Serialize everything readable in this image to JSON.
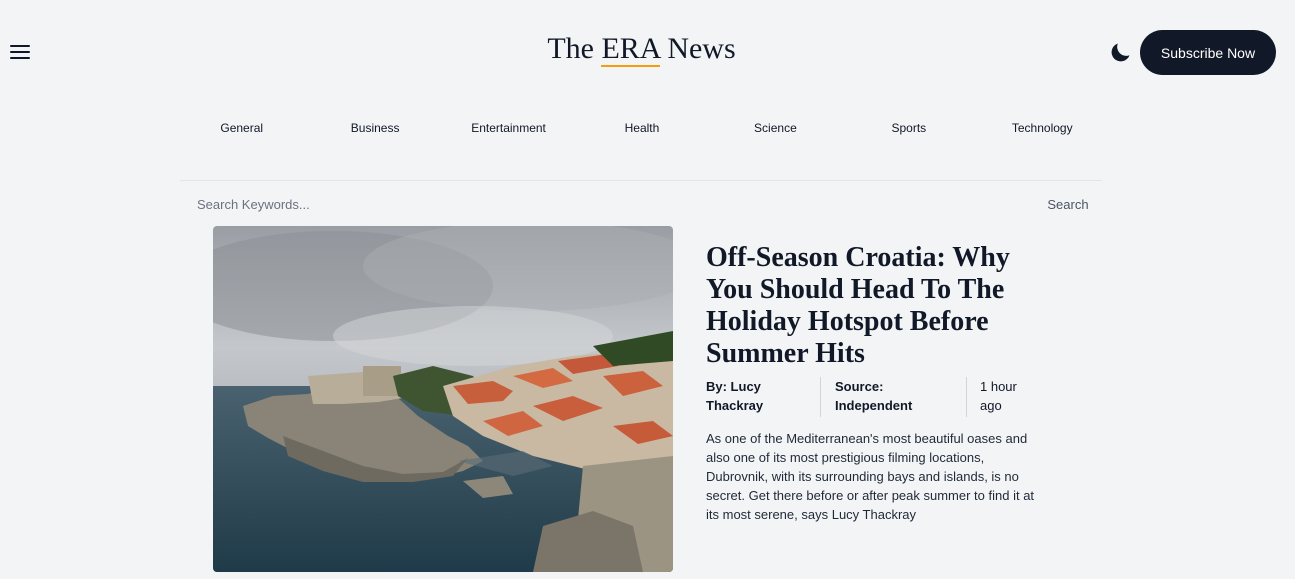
{
  "header": {
    "logo_prefix": "The ",
    "logo_highlight": "ERA",
    "logo_suffix": " News",
    "subscribe_label": "Subscribe Now"
  },
  "categories": [
    "General",
    "Business",
    "Entertainment",
    "Health",
    "Science",
    "Sports",
    "Technology"
  ],
  "search": {
    "placeholder": "Search Keywords...",
    "button_label": "Search"
  },
  "article": {
    "title": "Off-Season Croatia: Why You Should Head To The Holiday Hotspot Before Summer Hits",
    "author": "By: Lucy Thackray",
    "source": "Source: Independent",
    "time": "1 hour ago",
    "summary": "As one of the Mediterranean's most beautiful oases and also one of its most prestigious filming locations, Dubrovnik, with its surrounding bays and islands, is no secret. Get there before or after peak summer to find it at its most serene, says Lucy Thackray"
  },
  "colors": {
    "background": "#f3f4f6",
    "primary_dark": "#111827",
    "accent_underline": "#f59e0b"
  },
  "icons": {
    "menu": "hamburger-menu-icon",
    "theme": "moon-icon"
  }
}
